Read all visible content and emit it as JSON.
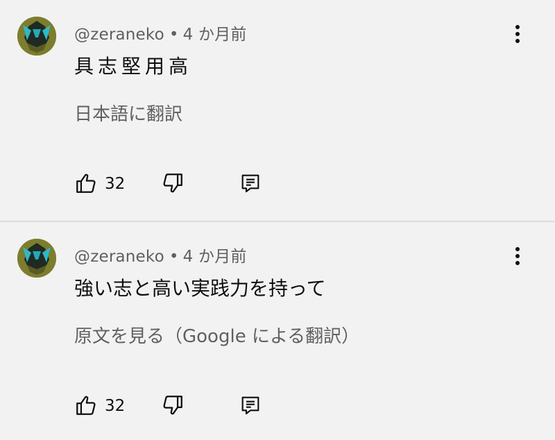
{
  "comments": [
    {
      "author": "@zeraneko",
      "separator": "•",
      "time": "4 か月前",
      "text": "具志堅用高",
      "translate_label": "日本語に翻訳",
      "like_count": "32"
    },
    {
      "author": "@zeraneko",
      "separator": "•",
      "time": "4 か月前",
      "text": "強い志と高い実践力を持って",
      "translate_label": "原文を見る（Google による翻訳）",
      "like_count": "32"
    }
  ],
  "icons": {
    "like": "thumbs-up-icon",
    "dislike": "thumbs-down-icon",
    "reply": "reply-icon",
    "more": "more-vertical-icon"
  },
  "colors": {
    "background": "#f2f2f2",
    "primary_text": "#0f0f0f",
    "secondary_text": "#606060"
  }
}
